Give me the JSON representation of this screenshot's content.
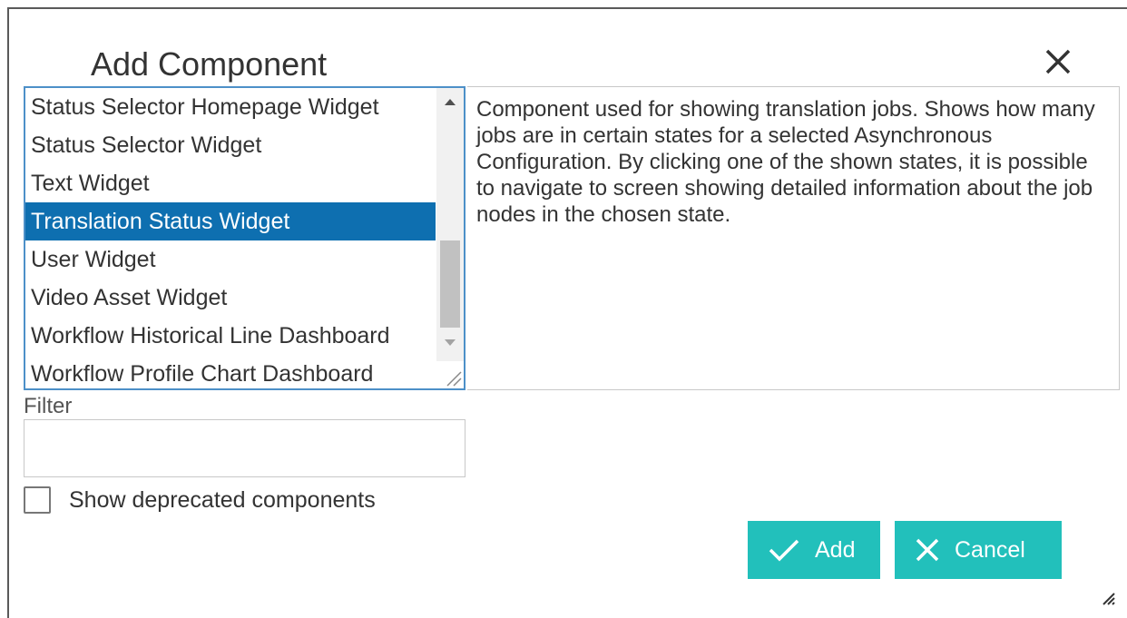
{
  "dialog": {
    "title": "Add Component",
    "close_icon": "close-icon"
  },
  "list": {
    "items": [
      {
        "label": "Status Selector Homepage Widget",
        "selected": false
      },
      {
        "label": "Status Selector Widget",
        "selected": false
      },
      {
        "label": "Text Widget",
        "selected": false
      },
      {
        "label": "Translation Status Widget",
        "selected": true
      },
      {
        "label": "User Widget",
        "selected": false
      },
      {
        "label": "Video Asset Widget",
        "selected": false
      },
      {
        "label": "Workflow Historical Line Dashboard",
        "selected": false
      },
      {
        "label": "Workflow Profile Chart Dashboard",
        "selected": false
      }
    ],
    "selected_color": "#0e6fb0",
    "scroll_position": 0.72
  },
  "description": {
    "text": "Component used for showing translation jobs. Shows how many jobs are in certain states for a selected Asynchronous Configuration. By clicking one of the shown states, it is possible to navigate to screen showing detailed information about the job nodes in the chosen state."
  },
  "filter": {
    "label": "Filter",
    "value": "",
    "placeholder": ""
  },
  "deprecated": {
    "label": "Show deprecated components",
    "checked": false
  },
  "buttons": {
    "add_label": "Add",
    "add_icon": "check-icon",
    "cancel_label": "Cancel",
    "cancel_icon": "close-icon",
    "color": "#22c0bb"
  }
}
